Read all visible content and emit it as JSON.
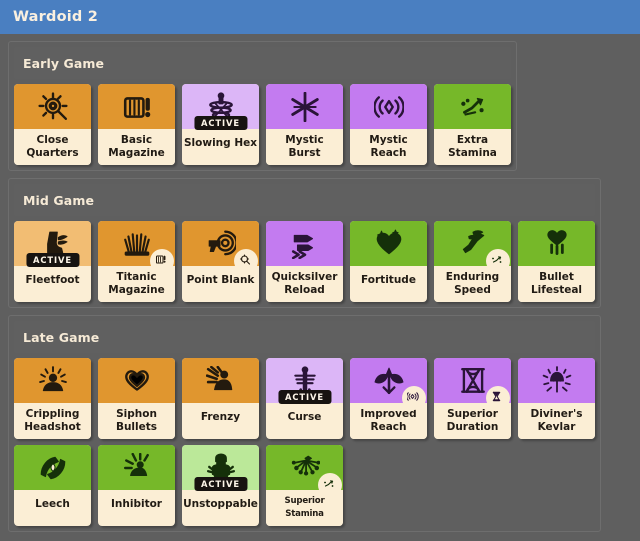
{
  "window": {
    "title": "Wardoid 2"
  },
  "colors": {
    "titlebar": "#4a7fc1",
    "page_background": "#5f5f5f",
    "panel": "#5f5f5f",
    "section_header": "#606060",
    "card_label_background": "#fbeed5",
    "tier_early_orange": "#e0962f",
    "tier_purple": "#c37bf0",
    "tier_green": "#76b829",
    "active_badge": "#171310"
  },
  "active_badge_label": "ACTIVE",
  "sections": [
    {
      "title": "Early Game",
      "rows": [
        [
          {
            "name": "Close Quarters",
            "tier": "orange",
            "icon": "crosshair-magnifier-icon",
            "active": false,
            "sub_badge": null
          },
          {
            "name": "Basic Magazine",
            "tier": "orange",
            "icon": "magazine-icon",
            "active": false,
            "sub_badge": null
          },
          {
            "name": "Slowing Hex",
            "tier": "purple",
            "icon": "hex-totem-icon",
            "active": true,
            "sub_badge": null
          },
          {
            "name": "Mystic Burst",
            "tier": "purple",
            "icon": "starburst-icon",
            "active": false,
            "sub_badge": null
          },
          {
            "name": "Mystic Reach",
            "tier": "purple",
            "icon": "sonar-diamond-icon",
            "active": false,
            "sub_badge": null
          },
          {
            "name": "Extra Stamina",
            "tier": "green",
            "icon": "running-spark-icon",
            "active": false,
            "sub_badge": null
          }
        ]
      ]
    },
    {
      "title": "Mid Game",
      "rows": [
        [
          {
            "name": "Fleetfoot",
            "tier": "orange",
            "icon": "winged-boot-icon",
            "active": true,
            "sub_badge": null
          },
          {
            "name": "Titanic Magazine",
            "tier": "orange",
            "icon": "wheat-burst-icon",
            "active": false,
            "sub_badge": "magazine-badge-icon"
          },
          {
            "name": "Point Blank",
            "tier": "orange",
            "icon": "pistol-target-icon",
            "active": false,
            "sub_badge": "magnifier-badge-icon"
          },
          {
            "name": "Quicksilver Reload",
            "tier": "purple",
            "icon": "speed-bullets-icon",
            "active": false,
            "sub_badge": null
          },
          {
            "name": "Fortitude",
            "tier": "green",
            "icon": "sparkle-heart-icon",
            "active": false,
            "sub_badge": null
          },
          {
            "name": "Enduring Speed",
            "tier": "green",
            "icon": "winged-leg-icon",
            "active": false,
            "sub_badge": "running-badge-icon"
          },
          {
            "name": "Bullet Lifesteal",
            "tier": "green",
            "icon": "heart-drops-icon",
            "active": false,
            "sub_badge": null
          }
        ]
      ]
    },
    {
      "title": "Late Game",
      "rows": [
        [
          {
            "name": "Crippling Headshot",
            "tier": "orange",
            "icon": "headshot-burst-icon",
            "active": false,
            "sub_badge": null
          },
          {
            "name": "Siphon Bullets",
            "tier": "orange",
            "icon": "double-heart-icon",
            "active": false,
            "sub_badge": null
          },
          {
            "name": "Frenzy",
            "tier": "orange",
            "icon": "frenzy-rage-icon",
            "active": false,
            "sub_badge": null
          },
          {
            "name": "Curse",
            "tier": "purple",
            "icon": "cursed-figure-icon",
            "active": true,
            "sub_badge": null
          },
          {
            "name": "Improved Reach",
            "tier": "purple",
            "icon": "winged-arrow-icon",
            "active": false,
            "sub_badge": "sonar-badge-icon"
          },
          {
            "name": "Superior Duration",
            "tier": "purple",
            "icon": "hourglass-frame-icon",
            "active": false,
            "sub_badge": "hourglass-badge-icon"
          },
          {
            "name": "Diviner's Kevlar",
            "tier": "purple",
            "icon": "radiant-dome-icon",
            "active": false,
            "sub_badge": null
          }
        ],
        [
          {
            "name": "Leech",
            "tier": "green",
            "icon": "leech-heart-icon",
            "active": false,
            "sub_badge": null
          },
          {
            "name": "Inhibitor",
            "tier": "green",
            "icon": "kneeling-burst-icon",
            "active": false,
            "sub_badge": null
          },
          {
            "name": "Unstoppable",
            "tier": "green",
            "icon": "armored-brute-icon",
            "active": true,
            "sub_badge": null
          },
          {
            "name": "Superior Stamina",
            "tier": "green",
            "icon": "spark-burst-icon",
            "active": false,
            "sub_badge": "running-badge-icon",
            "small_label": true
          }
        ]
      ]
    }
  ]
}
